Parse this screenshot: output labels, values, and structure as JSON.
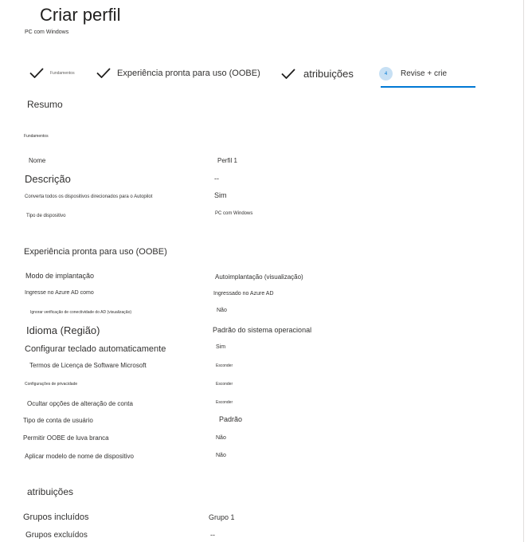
{
  "header": {
    "title": "Criar perfil",
    "subtitle": "PC com Windows"
  },
  "steps": [
    {
      "label": "Fundamentos"
    },
    {
      "label": "Experiência pronta para uso (OOBE)"
    },
    {
      "label": "atribuições"
    },
    {
      "label": "Revise + crie",
      "badge": "4"
    }
  ],
  "summary": {
    "title": "Resumo",
    "basics": {
      "heading": "Fundamentos",
      "name_label": "Nome",
      "name_value": "Perfil 1",
      "description_label": "Descrição",
      "description_value": "--",
      "convert_label": "Converta todos os dispositivos direcionados para o Autopilot",
      "convert_value": "Sim",
      "device_type_label": "Tipo de dispositivo",
      "device_type_value": "PC com Windows"
    },
    "oobe": {
      "heading": "Experiência pronta para uso (OOBE)",
      "deploy_mode_label": "Modo de implantação",
      "deploy_mode_value": "Autoimplantação (visualização)",
      "join_label": "Ingresse no Azure AD como",
      "join_value": "Ingressado no Azure AD",
      "skip_ad_label": "Ignorar verificação de conectividade do AD (visualização)",
      "skip_ad_value": "Não",
      "language_label": "Idioma (Região)",
      "language_value": "Padrão do sistema operacional",
      "keyboard_label": "Configurar teclado automaticamente",
      "keyboard_value": "Sim",
      "license_label": "Termos de Licença de Software Microsoft",
      "license_value": "Esconder",
      "privacy_label": "Configurações de privacidade",
      "privacy_value": "Esconder",
      "account_opts_label": "Ocultar opções de alteração de conta",
      "account_opts_value": "Esconder",
      "account_type_label": "Tipo de conta de usuário",
      "account_type_value": "Padrão",
      "white_glove_label": "Permitir OOBE de luva branca",
      "white_glove_value": "Não",
      "device_name_label": "Aplicar modelo de nome de dispositivo",
      "device_name_value": "Não"
    },
    "assignments": {
      "heading": "atribuições",
      "included_label": "Grupos incluídos",
      "included_value": "Grupo 1",
      "excluded_label": "Grupos excluídos",
      "excluded_value": "--"
    }
  },
  "colors": {
    "accent": "#0078d4",
    "active_circle": "#c7e0f4",
    "text": "#323130"
  }
}
